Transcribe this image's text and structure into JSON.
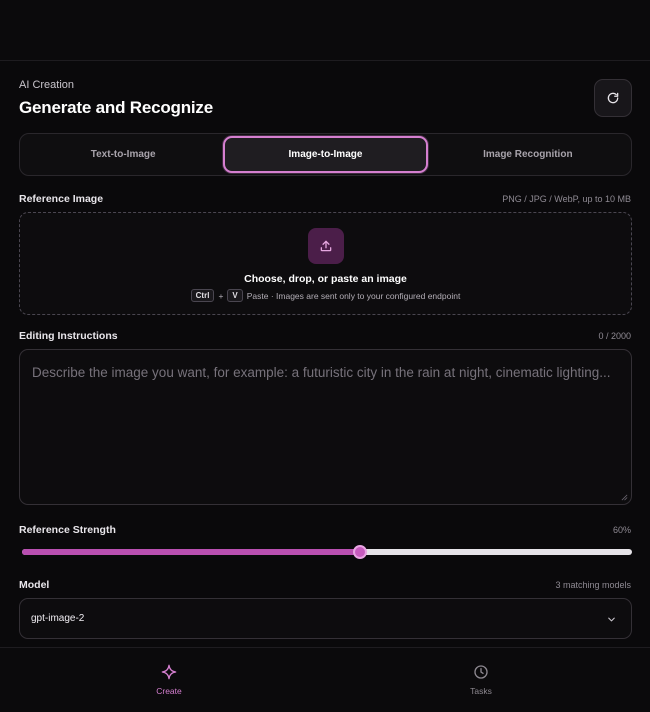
{
  "header": {
    "subtitle": "AI Creation",
    "title": "Generate and Recognize",
    "refresh_icon": "refresh-icon"
  },
  "tabs": [
    {
      "label": "Text-to-Image",
      "active": false
    },
    {
      "label": "Image-to-Image",
      "active": true
    },
    {
      "label": "Image Recognition",
      "active": false
    }
  ],
  "reference": {
    "label": "Reference Image",
    "hint": "PNG / JPG / WebP, up to 10 MB",
    "drop_title": "Choose, drop, or paste an image",
    "key_ctrl": "Ctrl",
    "key_plus": "+",
    "key_v": "V",
    "drop_hint": "Paste · Images are sent only to your configured endpoint",
    "icon": "upload-icon"
  },
  "instructions": {
    "label": "Editing Instructions",
    "counter": "0 / 2000",
    "value": "",
    "placeholder": "Describe the image you want, for example: a futuristic city in the rain at night, cinematic lighting..."
  },
  "strength": {
    "label": "Reference Strength",
    "value_text": "60%",
    "value": 0.6
  },
  "model": {
    "label": "Model",
    "hint": "3 matching models",
    "selected": "gpt-image-2"
  },
  "nav": {
    "create": "Create",
    "tasks": "Tasks"
  },
  "colors": {
    "accent": "#d57fd0",
    "slider_fill": "#b94fb1",
    "background": "#0a090b"
  }
}
